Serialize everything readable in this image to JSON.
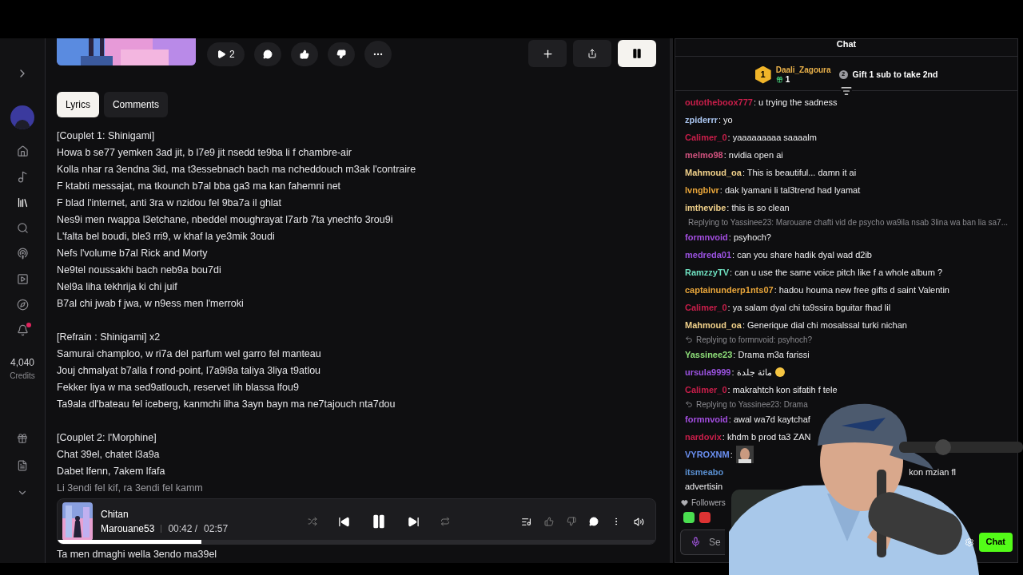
{
  "sidebar": {
    "items": [
      {
        "selected": false,
        "badge": false
      },
      {
        "selected": false,
        "badge": false
      },
      {
        "selected": true,
        "badge": false
      },
      {
        "selected": false,
        "badge": false
      },
      {
        "selected": false,
        "badge": false
      },
      {
        "selected": false,
        "badge": false
      },
      {
        "selected": false,
        "badge": false
      },
      {
        "selected": false,
        "badge": true
      }
    ],
    "credits": "4,040",
    "credits_label": "Credits"
  },
  "song": {
    "play_count": "2"
  },
  "tabs": [
    {
      "label": "Lyrics",
      "selected": true
    },
    {
      "label": "Comments",
      "selected": false
    }
  ],
  "lyrics": [
    [
      "[Couplet 1: Shinigami]",
      "Howa b se77 yemken 3ad jit, b l7e9 jit nsedd te9ba li f chambre-air",
      "Kolla nhar ra 3endna 3id, ma t3essebnach bach ma ncheddouch m3ak l'contraire",
      "F ktabti messajat, ma tkounch b7al bba ga3 ma kan fahemni net",
      "F blad l'internet, anti 3ra w nzidou fel 9ba7a il ghlat",
      "Nes9i men rwappa l3etchane, nbeddel moughrayat l7arb 7ta ynechfo 3rou9i",
      "L'falta bel boudi, ble3 rri9, w khaf la ye3mik 3oudi",
      "Nefs l'volume b7al Rick and Morty",
      "Ne9tel noussakhi bach neb9a bou7di",
      "Nel9a liha tekhrija ki chi juif",
      "B7al chi jwab f jwa, w n9ess men l'merroki"
    ],
    [
      "[Refrain : Shinigami] x2",
      "Samurai champloo, w ri7a del parfum wel garro fel manteau",
      "Jouj chmalyat b7alla f rond-point, l7a9i9a taliya 3liya t9atlou",
      "Fekker liya w ma sed9atlouch, reservet lih blassa lfou9",
      "Ta9ala dl'bateau fel iceberg, kanmchi liha 3ayn bayn ma ne7tajouch nta7dou"
    ],
    [
      "[Couplet 2: l'Morphine]",
      "Chat 39el, chatet l3a9a",
      "Dabet lfenn, 7akem lfafa",
      "Li 3endi fel kif, ra 3endi fel kamm"
    ]
  ],
  "lyrics_after_player": "Ta men dmaghi wella 3endo ma39el",
  "player": {
    "title": "Chitan",
    "artist": "Marouane53",
    "elapsed": "00:42 /",
    "duration": "02:57",
    "level": 0.24
  },
  "chat": {
    "title": "Chat",
    "leader": {
      "rank": "1",
      "name": "Daali_Zagoura",
      "gifts": "1",
      "next_rank": "2",
      "next_text": "Gift 1 sub to take 2nd"
    },
    "messages": [
      {
        "kind": "text",
        "user": "outotheboox777",
        "color": "#c81e4a",
        "text": ": u trying the sadness"
      },
      {
        "kind": "text",
        "user": "zpiderrr",
        "color": "#a9c4ef",
        "text": ": yo"
      },
      {
        "kind": "text",
        "user": "Calimer_0",
        "color": "#c81e4a",
        "text": ": yaaaaaaaaa saaaalm"
      },
      {
        "kind": "text",
        "user": "melmo98",
        "color": "#d0527e",
        "text": ": nvidia open ai"
      },
      {
        "kind": "text",
        "user": "Mahmoud_oa",
        "color": "#f0d08a",
        "text": ": This is beautiful... damn it ai"
      },
      {
        "kind": "text",
        "user": "lvngblvr",
        "color": "#e8a53a",
        "text": ": dak lyamani li tal3trend had lyamat"
      },
      {
        "kind": "text",
        "user": "imthevibe",
        "color": "#f0d08a",
        "text": ": this is so clean"
      },
      {
        "kind": "text",
        "user": "formnvoid",
        "color": "#a34ee0",
        "text": ": psyhoch?",
        "reply": "Replying to Yassinee23: Marouane chafti vid de psycho wa9ila nsab 3lina wa ban lia sa7..."
      },
      {
        "kind": "text",
        "user": "medreda01",
        "color": "#9a52e0",
        "text": ": can you share hadik dyal wad d2ib"
      },
      {
        "kind": "text",
        "user": "RamzzyTV",
        "color": "#6fe0c0",
        "text": ": can u use the same voice pitch like f a whole album ?"
      },
      {
        "kind": "text",
        "user": "captainunderp1nts07",
        "color": "#e8a53a",
        "text": ": hadou houma new free gifts d saint Valentin"
      },
      {
        "kind": "text",
        "user": "Calimer_0",
        "color": "#c81e4a",
        "text": ": ya salam dyal chi ta9ssira bguitar fhad lil"
      },
      {
        "kind": "text",
        "user": "Mahmoud_oa",
        "color": "#f0d08a",
        "text": ": Generique dial chi mosalssal turki nichan"
      },
      {
        "kind": "text",
        "user": "Yassinee23",
        "color": "#8fe07a",
        "text": ": Drama m3a farissi",
        "reply": "Replying to formnvoid: psyhoch?"
      },
      {
        "kind": "emoji",
        "user": "ursula9999",
        "color": "#9a52e0",
        "text": ": مائة جلدة"
      },
      {
        "kind": "text",
        "user": "Calimer_0",
        "color": "#c81e4a",
        "text": ": makrahtch kon sifatih f tele"
      },
      {
        "kind": "text",
        "user": "formnvoid",
        "color": "#a34ee0",
        "text": ": awal wa7d kaytchaf",
        "reply": "Replying to Yassinee23: Drama"
      },
      {
        "kind": "text",
        "user": "nardovix",
        "color": "#c81e4a",
        "text": ": khdm b prod ta3 ZAN"
      },
      {
        "user": "VYROXNM",
        "color": "#6a8ff0",
        "text": ":"
      },
      {
        "kind": "split",
        "user": "itsmeabo",
        "color": "#5a8fd0",
        "text": "kon mzian fl",
        "line_2": "advertisin"
      }
    ],
    "followers": "Followers",
    "placeholder": "Se",
    "send": "Chat"
  }
}
